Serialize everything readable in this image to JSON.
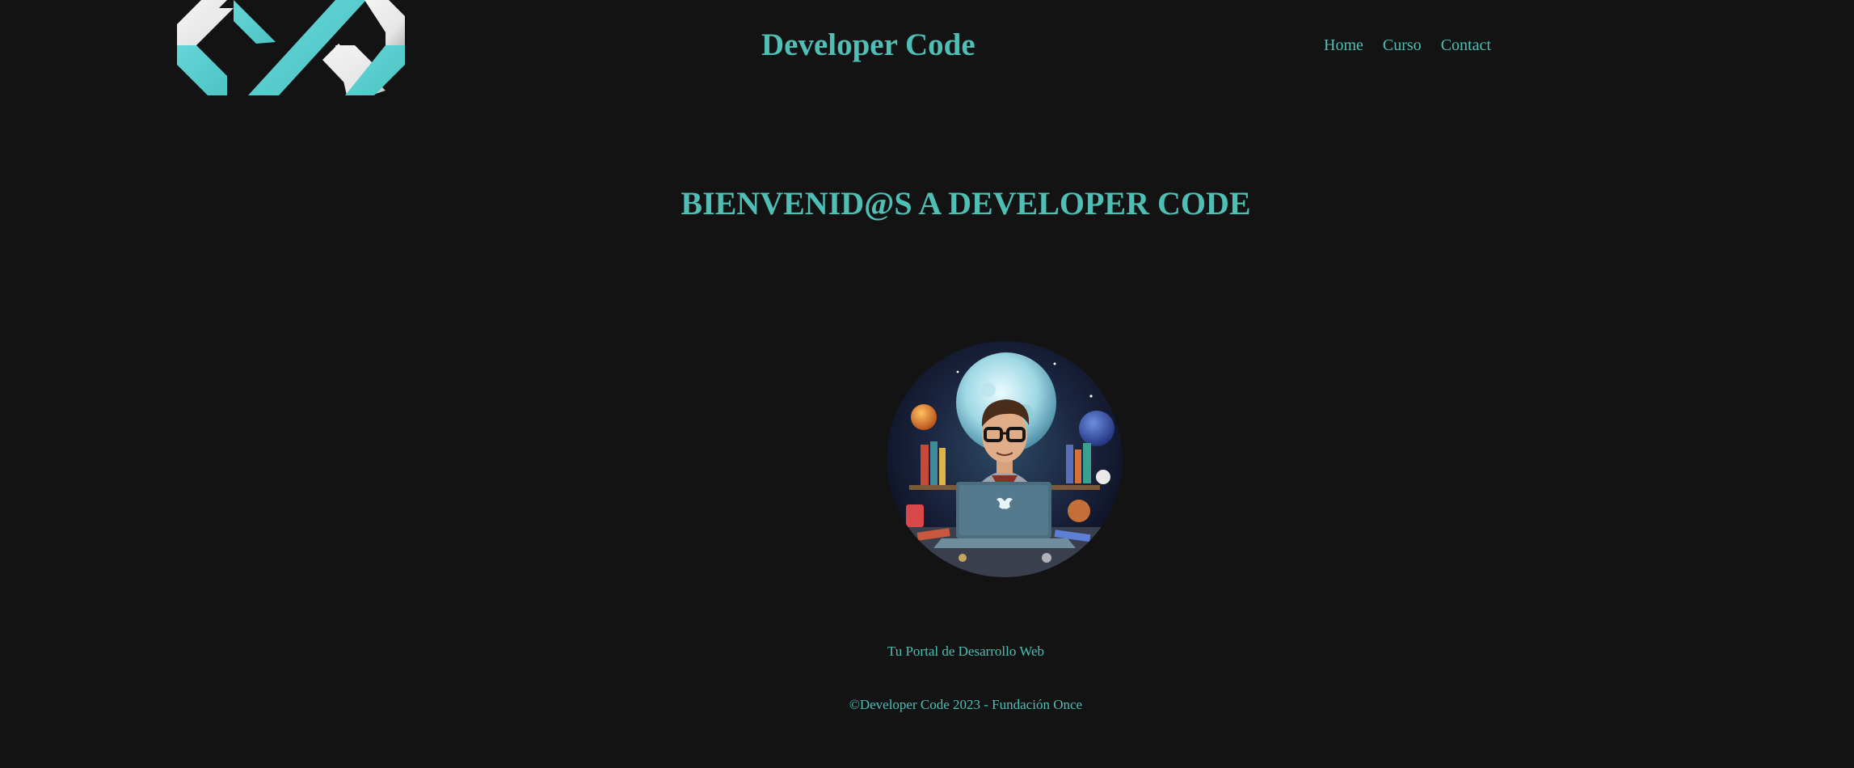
{
  "header": {
    "logo_icon": "developer-code-logo-icon",
    "site_title": "Developer Code"
  },
  "nav": {
    "items": [
      {
        "label": "Home"
      },
      {
        "label": "Curso"
      },
      {
        "label": "Contact"
      }
    ]
  },
  "main": {
    "welcome_heading": "BIENVENID@S A DEVELOPER CODE",
    "hero_image_icon": "developer-illustration-icon",
    "tagline": "Tu Portal de Desarrollo Web"
  },
  "footer": {
    "text": "©Developer Code 2023 - Fundación Once"
  },
  "colors": {
    "background": "#131313",
    "accent": "#4fbfb6",
    "logo_teal": "#5ccfd0",
    "logo_white": "#ececec"
  }
}
